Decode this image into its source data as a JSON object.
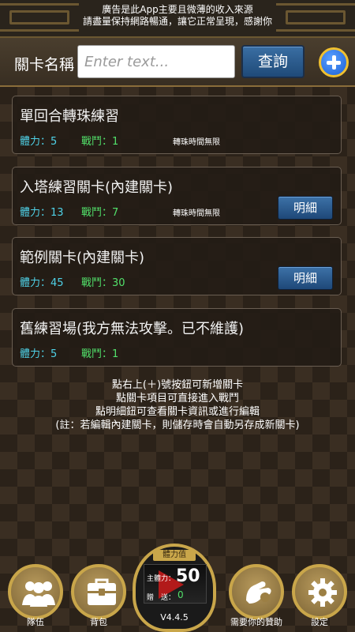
{
  "banner": {
    "line1": "廣告是此App主要且微薄的收入來源",
    "line2": "請盡量保持網路暢通，讓它正常呈現，感謝你"
  },
  "search": {
    "label": "關卡名稱",
    "placeholder": "Enter text...",
    "value": "",
    "query_label": "查詢",
    "add_icon": "plus-circle-icon"
  },
  "stats_labels": {
    "stamina": "體力：",
    "battle": "戰鬥："
  },
  "stages": [
    {
      "title": "單回合轉珠練習",
      "stamina": "5",
      "battle": "1",
      "note": "轉珠時間無限",
      "detail": ""
    },
    {
      "title": "入塔練習關卡(內建關卡)",
      "stamina": "13",
      "battle": "7",
      "note": "轉珠時間無限",
      "detail": "明細"
    },
    {
      "title": "範例關卡(內建關卡)",
      "stamina": "45",
      "battle": "30",
      "note": "",
      "detail": "明細"
    },
    {
      "title": "舊練習場(我方無法攻擊。已不維護)",
      "stamina": "5",
      "battle": "1",
      "note": "",
      "detail": ""
    }
  ],
  "help": {
    "line1": "點右上(＋)號按鈕可新增關卡",
    "line2": "點關卡項目可直接進入戰鬥",
    "line3": "點明細鈕可查看關卡資訊或進行編輯",
    "line4": "(註：若編輯內建關卡，則儲存時會自動另存成新關卡)"
  },
  "nav": {
    "team": {
      "label": "隊伍",
      "icon": "team-icon"
    },
    "bag": {
      "label": "背包",
      "icon": "bag-icon"
    },
    "support": {
      "label": "需要你的贊助",
      "icon": "support-icon"
    },
    "settings": {
      "label": "設定",
      "icon": "gear-icon"
    }
  },
  "stamina_widget": {
    "header": "體力值",
    "main_label": "主體力：",
    "main_value": "50",
    "gift_label": "贈　送：",
    "gift_value": "0",
    "version": "V4.4.5"
  },
  "colors": {
    "stamina_stat": "#4fd2e8",
    "battle_stat": "#52e06a",
    "button_blue": "#2a5a8c",
    "gold_frame": "#c9a64a"
  }
}
